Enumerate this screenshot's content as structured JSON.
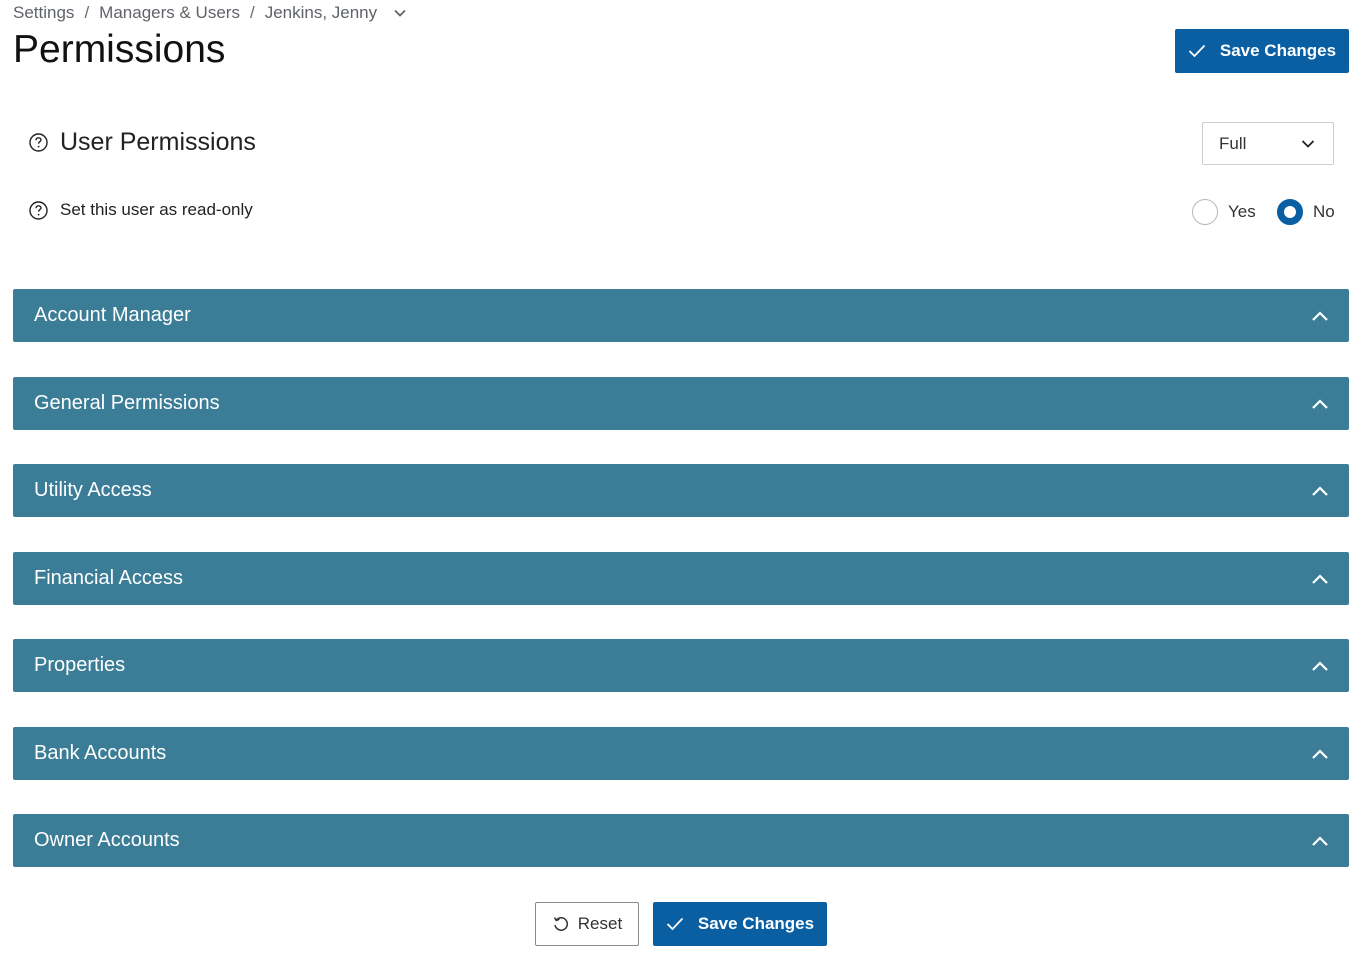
{
  "breadcrumb": {
    "items": [
      "Settings",
      "Managers & Users",
      "Jenkins, Jenny"
    ],
    "separator": "/"
  },
  "page_title": "Permissions",
  "header": {
    "save_label": "Save Changes"
  },
  "user_permissions": {
    "label": "User Permissions",
    "select_value": "Full"
  },
  "readonly": {
    "label": "Set this user as read-only",
    "options": [
      "Yes",
      "No"
    ],
    "selected": "No"
  },
  "sections": [
    {
      "label": "Account Manager"
    },
    {
      "label": "General Permissions"
    },
    {
      "label": "Utility Access"
    },
    {
      "label": "Financial Access"
    },
    {
      "label": "Properties"
    },
    {
      "label": "Bank Accounts"
    },
    {
      "label": "Owner Accounts"
    }
  ],
  "footer": {
    "reset_label": "Reset",
    "save_label": "Save Changes"
  },
  "colors": {
    "primary": "#0a5fa3",
    "accordion": "#3b7d96"
  },
  "icons": {
    "help": "question-circle-icon",
    "check": "check-icon",
    "reset": "reset-icon",
    "chevron_down": "chevron-down-icon",
    "chevron_up": "chevron-up-icon"
  }
}
